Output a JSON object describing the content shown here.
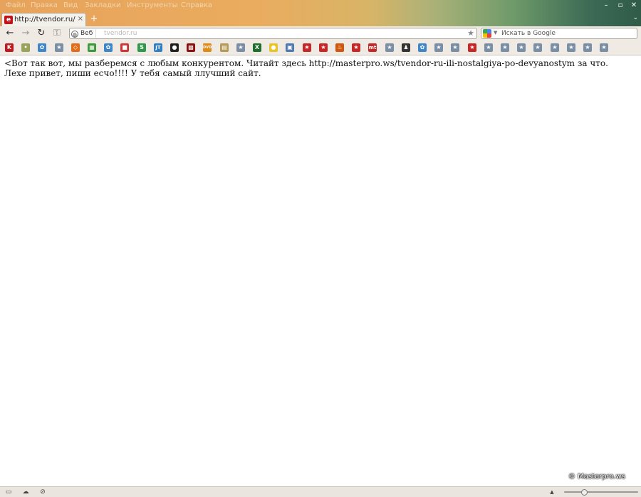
{
  "menubar": {
    "items": [
      "Файл",
      "Правка",
      "Вид",
      "Закладки",
      "Инструменты",
      "Справка"
    ]
  },
  "window_controls": {
    "minimize": "–",
    "restore": "▫",
    "close": "✕"
  },
  "tabs": [
    {
      "title": "http://tvendor.ru/",
      "close": "×"
    }
  ],
  "newtab": "+",
  "toolbar": {
    "back": "←",
    "forward": "→",
    "reload": "↻",
    "key": "⚿"
  },
  "urlbar": {
    "identity_label": "Веб",
    "url": "tvendor.ru",
    "bookmark_star": "★"
  },
  "searchbar": {
    "placeholder": "Искать в Google"
  },
  "bookmarks": [
    {
      "icon": "k-icon",
      "color": "#c2171c",
      "glyph": "K"
    },
    {
      "icon": "balloon-icon",
      "color": "#9aa35a",
      "glyph": "•"
    },
    {
      "icon": "flower-icon",
      "color": "#3c86c9",
      "glyph": "✿"
    },
    {
      "icon": "star-doc-icon",
      "color": "#7a8ea5",
      "glyph": "★"
    },
    {
      "icon": "code-icon",
      "color": "#e06d1b",
      "glyph": "◇"
    },
    {
      "icon": "grid-icon",
      "color": "#3a9a3a",
      "glyph": "▦"
    },
    {
      "icon": "flower-icon",
      "color": "#3c86c9",
      "glyph": "✿"
    },
    {
      "icon": "squares-icon",
      "color": "#d23434",
      "glyph": "■"
    },
    {
      "icon": "green-s-icon",
      "color": "#2c9a49",
      "glyph": "S"
    },
    {
      "icon": "jt-icon",
      "color": "#2f7fc4",
      "glyph": "JT"
    },
    {
      "icon": "github-icon",
      "color": "#222222",
      "glyph": "●"
    },
    {
      "icon": "film-icon",
      "color": "#8b1010",
      "glyph": "▩"
    },
    {
      "icon": "dvd-icon",
      "color": "#e08a14",
      "glyph": "DVD"
    },
    {
      "icon": "folder-icon",
      "color": "#b49a55",
      "glyph": "▤"
    },
    {
      "icon": "star-doc-icon",
      "color": "#7a8ea5",
      "glyph": "★"
    },
    {
      "icon": "x-icon",
      "color": "#1e6f2b",
      "glyph": "X"
    },
    {
      "icon": "bulb-icon",
      "color": "#e7c52a",
      "glyph": "●"
    },
    {
      "icon": "picture-icon",
      "color": "#4f79b3",
      "glyph": "▣"
    },
    {
      "icon": "red-star-icon",
      "color": "#c62828",
      "glyph": "★"
    },
    {
      "icon": "red-star-icon",
      "color": "#c62828",
      "glyph": "★"
    },
    {
      "icon": "fire-icon",
      "color": "#d3560f",
      "glyph": "♨"
    },
    {
      "icon": "red-star-icon",
      "color": "#c62828",
      "glyph": "★"
    },
    {
      "icon": "mt-icon",
      "color": "#c62828",
      "glyph": "mt"
    },
    {
      "icon": "star-doc-icon",
      "color": "#7a8ea5",
      "glyph": "★"
    },
    {
      "icon": "penguin-icon",
      "color": "#333333",
      "glyph": "♟"
    },
    {
      "icon": "flower-icon",
      "color": "#3c86c9",
      "glyph": "✿"
    },
    {
      "icon": "star-doc-icon",
      "color": "#7a8ea5",
      "glyph": "★"
    },
    {
      "icon": "star-doc-icon",
      "color": "#7a8ea5",
      "glyph": "★"
    },
    {
      "icon": "red-star-icon",
      "color": "#c62828",
      "glyph": "★"
    },
    {
      "icon": "star-doc-icon",
      "color": "#7a8ea5",
      "glyph": "★"
    },
    {
      "icon": "star-doc-icon",
      "color": "#7a8ea5",
      "glyph": "★"
    },
    {
      "icon": "star-doc-icon",
      "color": "#7a8ea5",
      "glyph": "★"
    },
    {
      "icon": "star-doc-icon",
      "color": "#7a8ea5",
      "glyph": "★"
    },
    {
      "icon": "star-doc-icon",
      "color": "#7a8ea5",
      "glyph": "★"
    },
    {
      "icon": "star-doc-icon",
      "color": "#7a8ea5",
      "glyph": "★"
    },
    {
      "icon": "star-doc-icon",
      "color": "#7a8ea5",
      "glyph": "★"
    },
    {
      "icon": "star-doc-icon",
      "color": "#7a8ea5",
      "glyph": "★"
    }
  ],
  "content": {
    "text": "<Вот так вот, мы разберемся с любым конкурентом. Читайт здесь http://masterpro.ws/tvendor-ru-ili-nostalgiya-po-devyanostym за что. Лехе привет, пиши есчо!!!! У тебя самый ллучший сайт."
  },
  "watermark": "© Masterpro.ws",
  "statusbar": {
    "icons": [
      "panel-icon",
      "cloud-icon",
      "download-icon"
    ],
    "up_arrow": "▲"
  }
}
